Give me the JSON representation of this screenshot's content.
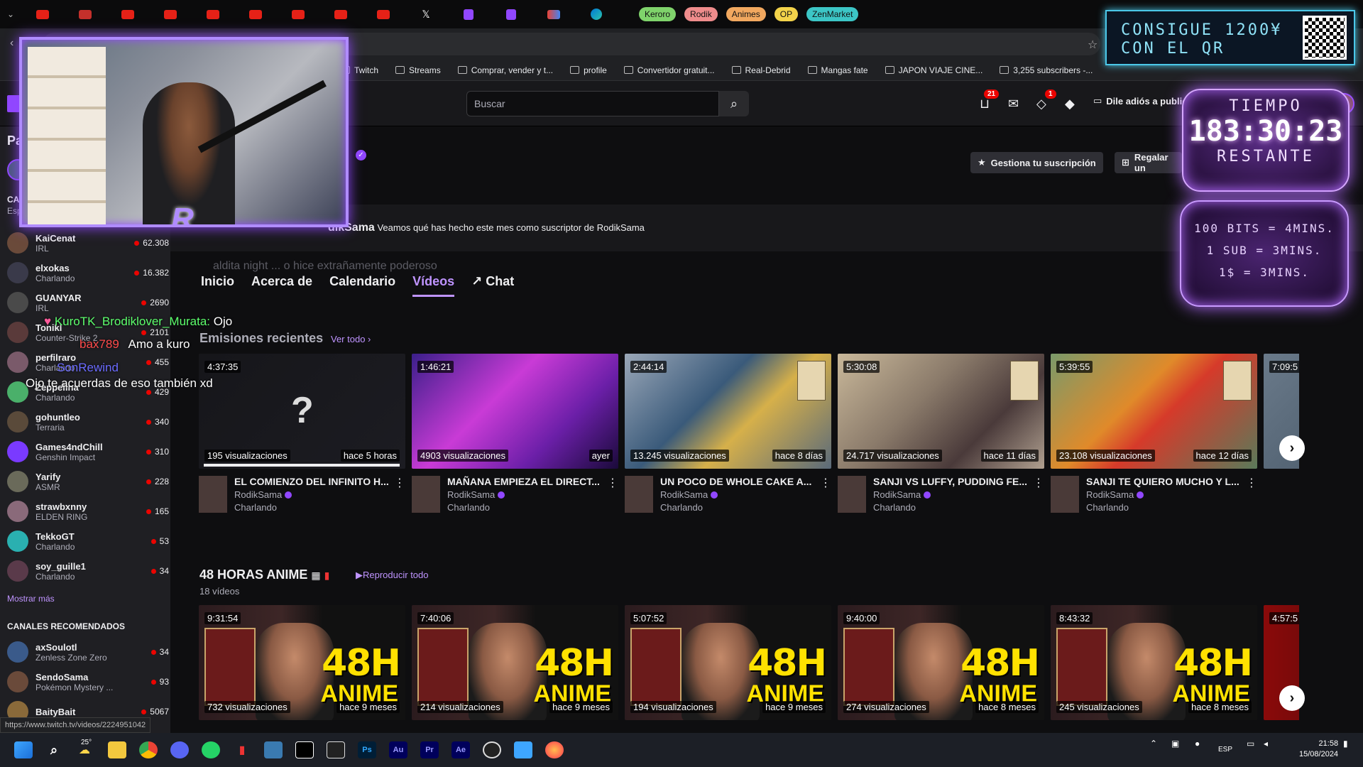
{
  "browser": {
    "tabs": [
      {
        "icon": "youtube-icon"
      },
      {
        "icon": "d-icon"
      },
      {
        "icon": "youtube-icon"
      },
      {
        "icon": "youtube-icon"
      },
      {
        "icon": "youtube-icon"
      },
      {
        "icon": "youtube-icon"
      },
      {
        "icon": "youtube-icon"
      },
      {
        "icon": "youtube-icon"
      },
      {
        "icon": "youtube-icon"
      },
      {
        "icon": "x-icon"
      },
      {
        "icon": "twitch-icon"
      },
      {
        "icon": "twitch-icon"
      },
      {
        "icon": "gmail-icon"
      },
      {
        "icon": "edge-icon"
      }
    ],
    "chips": [
      {
        "label": "Keroro",
        "color": "#7fd36b"
      },
      {
        "label": "Rodik",
        "color": "#ef8c8c"
      },
      {
        "label": "Animes",
        "color": "#f2a85f"
      },
      {
        "label": "OP",
        "color": "#f3d34a"
      },
      {
        "label": "ZenMarket",
        "color": "#3cc6c6"
      }
    ],
    "bookmarks": [
      "Twitch",
      "Streams",
      "Comprar, vender y t...",
      "profile",
      "Convertidor gratuit...",
      "Real-Debrid",
      "Mangas fate",
      "JAPON VIAJE CINE...",
      "3,255 subscribers -..."
    ],
    "status_url": "https://www.twitch.tv/videos/2224951042"
  },
  "nav": {
    "search_placeholder": "Buscar",
    "inbox_badge": "21",
    "notif_badge": "1",
    "adfree_label": "Dile adiós a public"
  },
  "sidebar": {
    "header": "Pa",
    "section_canales": "CA",
    "section_sub": "Esp",
    "channels": [
      {
        "name": "KaiCenat",
        "game": "IRL",
        "viewers": "62.308",
        "color": "#6a4a3a"
      },
      {
        "name": "elxokas",
        "game": "Charlando",
        "viewers": "16.382",
        "color": "#3a3a4a"
      },
      {
        "name": "GUANYAR",
        "game": "IRL",
        "viewers": "2690",
        "color": "#4a4a4a"
      },
      {
        "name": "Tonikl",
        "game": "Counter-Strike 2",
        "viewers": "2101",
        "color": "#5a3a3a"
      },
      {
        "name": "perfilraro",
        "game": "Charlando",
        "viewers": "455",
        "color": "#7a5a6a"
      },
      {
        "name": "Zeppelina",
        "game": "Charlando",
        "viewers": "429",
        "color": "#4ab06a"
      },
      {
        "name": "gohuntleo",
        "game": "Terraria",
        "viewers": "340",
        "color": "#5a4a3a"
      },
      {
        "name": "Games4ndChill",
        "game": "Genshin Impact",
        "viewers": "310",
        "color": "#7a3aff"
      },
      {
        "name": "Yarify",
        "game": "ASMR",
        "viewers": "228",
        "color": "#6a6a5a"
      },
      {
        "name": "strawbxnny",
        "game": "ELDEN RING",
        "viewers": "165",
        "color": "#8a6a7a"
      },
      {
        "name": "TekkoGT",
        "game": "Charlando",
        "viewers": "53",
        "color": "#2ab0b0"
      },
      {
        "name": "soy_guille1",
        "game": "Charlando",
        "viewers": "34",
        "color": "#5a3a4a"
      }
    ],
    "show_more": "Mostrar más",
    "recommended_title": "CANALES RECOMENDADOS",
    "recommended": [
      {
        "name": "axSoulotl",
        "game": "Zenless Zone Zero",
        "viewers": "34",
        "color": "#3a5a8a"
      },
      {
        "name": "SendoSama",
        "game": "Pokémon Mystery ...",
        "viewers": "93",
        "color": "#6a4a3a"
      },
      {
        "name": "BaityBait",
        "game": "",
        "viewers": "5067",
        "color": "#8a6a3a"
      }
    ]
  },
  "channel": {
    "manage_sub": "Gestiona tu suscripción",
    "gift_sub": "Regalar un",
    "recap_name": "dikSama",
    "recap_text": "Veamos qué has hecho este mes como suscriptor de RodikSama",
    "tabs": [
      {
        "label": "Inicio",
        "active": false
      },
      {
        "label": "Acerca de",
        "active": false
      },
      {
        "label": "Calendario",
        "active": false
      },
      {
        "label": "Vídeos",
        "active": true
      },
      {
        "label": "Chat",
        "active": false
      }
    ]
  },
  "recent": {
    "title": "Emisiones recientes",
    "link": "Ver todo",
    "videos": [
      {
        "duration": "4:37:35",
        "views": "195 visualizaciones",
        "ago": "hace 5 horas",
        "title": "EL COMIENZO DEL INFINITO H...",
        "channel": "RodikSama",
        "category": "Charlando",
        "bg": "linear-gradient(135deg,#16161a,#1c1c22)"
      },
      {
        "duration": "1:46:21",
        "views": "4903 visualizaciones",
        "ago": "ayer",
        "title": "MAÑANA EMPIEZA EL DIRECT...",
        "channel": "RodikSama",
        "category": "Charlando",
        "bg": "linear-gradient(135deg,#3b1f8a 0%,#c93bd6 40%,#6b1fa8 70%,#1a0a3a 100%)"
      },
      {
        "duration": "2:44:14",
        "views": "13.245 visualizaciones",
        "ago": "hace 8 días",
        "title": "UN POCO DE WHOLE CAKE A...",
        "channel": "RodikSama",
        "category": "Charlando",
        "bg": "linear-gradient(135deg,#9aa7b8 0%,#3a5a7a 40%,#d6b04a 60%,#5a6a7a 100%)"
      },
      {
        "duration": "5:30:08",
        "views": "24.717 visualizaciones",
        "ago": "hace 11 días",
        "title": "SANJI VS LUFFY, PUDDING FE...",
        "channel": "RodikSama",
        "category": "Charlando",
        "bg": "linear-gradient(135deg,#c9b89a 0%,#8a7a6a 40%,#4a3a3a 70%,#b0a090 100%)"
      },
      {
        "duration": "5:39:55",
        "views": "23.108 visualizaciones",
        "ago": "hace 12 días",
        "title": "SANJI TE QUIERO MUCHO Y L...",
        "channel": "RodikSama",
        "category": "Charlando",
        "bg": "linear-gradient(135deg,#7a9a6a 0%,#e08a2a 40%,#d63a2a 55%,#5a7a5a 100%)"
      },
      {
        "duration": "7:09:5",
        "views": "",
        "ago": "",
        "title": "",
        "channel": "",
        "category": "",
        "bg": "linear-gradient(135deg,#6a7a8a,#3a4a5a)"
      }
    ]
  },
  "playlist": {
    "title": "48 HORAS ANIME",
    "link": "Reproducir todo",
    "count": "18 vídeos",
    "videos": [
      {
        "duration": "9:31:54",
        "views": "732 visualizaciones",
        "ago": "hace 9 meses",
        "big": "48H",
        "label": "ANIME"
      },
      {
        "duration": "7:40:06",
        "views": "214 visualizaciones",
        "ago": "hace 9 meses",
        "big": "48H",
        "label": "ANIME"
      },
      {
        "duration": "5:07:52",
        "views": "194 visualizaciones",
        "ago": "hace 9 meses",
        "big": "48H",
        "label": "ANIME"
      },
      {
        "duration": "9:40:00",
        "views": "274 visualizaciones",
        "ago": "hace 8 meses",
        "big": "48H",
        "label": "ANIME"
      },
      {
        "duration": "8:43:32",
        "views": "245 visualizaciones",
        "ago": "hace 8 meses",
        "big": "48H",
        "label": "ANIME"
      },
      {
        "duration": "4:57:5",
        "views": "",
        "ago": "",
        "big": "",
        "label": ""
      }
    ]
  },
  "overlay": {
    "ghost_text": "aldita night ... o hice extrañamente poderoso",
    "chat": [
      {
        "user": "KuroTK_Brodiklover_Murata:",
        "msg": "Ojo"
      },
      {
        "user": "bax789",
        "msg": "Amo a kuro"
      },
      {
        "user": "SonRewind",
        "msg": ""
      },
      {
        "user": "",
        "msg": "Ojo te acuerdas de eso también xd"
      }
    ],
    "qr_text": "CONSIGUE 1200¥\nCON EL QR",
    "timer_top": "TIEMPO",
    "timer_value": "183:30:23",
    "timer_bottom": "RESTANTE",
    "rates": [
      "100 BITS = 4MINS.",
      "1 SUB = 3MINS.",
      "1$ = 3MINS."
    ]
  },
  "taskbar": {
    "weather": "25°",
    "lang": "ESP",
    "time": "21:58",
    "date": "15/08/2024"
  }
}
